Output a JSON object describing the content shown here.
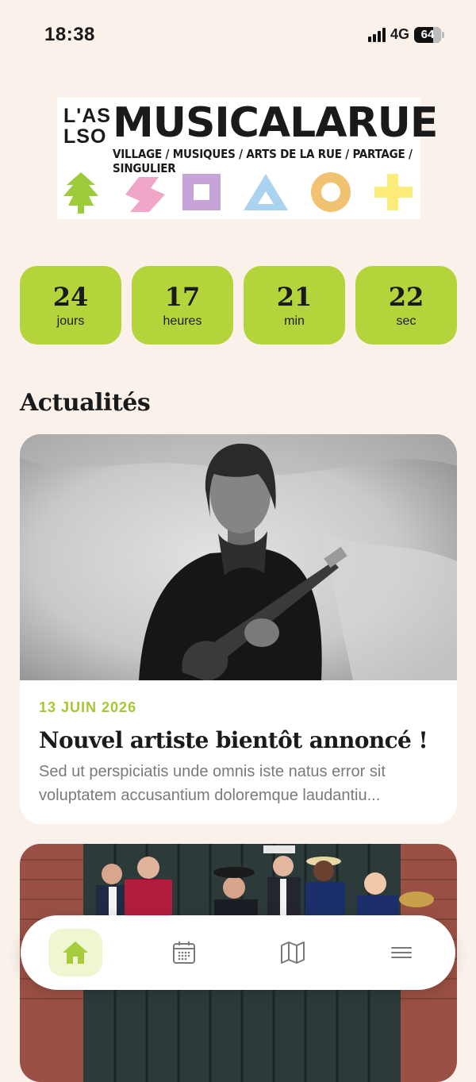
{
  "status_bar": {
    "time": "18:38",
    "network": "4G",
    "battery": "64"
  },
  "logo": {
    "aslo": [
      "L'AS",
      "LSO"
    ],
    "title": "MUSICALARUE",
    "tagline": "VILLAGE / MUSIQUES / ARTS DE LA RUE / PARTAGE / SINGULIER",
    "shapes": [
      {
        "icon": "tree-icon",
        "color": "#9ccb3b"
      },
      {
        "icon": "s-shape-icon",
        "color": "#f0a6c6"
      },
      {
        "icon": "square-icon",
        "color": "#c7a4d8"
      },
      {
        "icon": "triangle-icon",
        "color": "#a9d3ee"
      },
      {
        "icon": "circle-icon",
        "color": "#f0c272"
      },
      {
        "icon": "plus-icon",
        "color": "#fbec7a"
      }
    ]
  },
  "countdown": [
    {
      "value": "24",
      "label": "jours"
    },
    {
      "value": "17",
      "label": "heures"
    },
    {
      "value": "21",
      "label": "min"
    },
    {
      "value": "22",
      "label": "sec"
    }
  ],
  "section": {
    "title": "Actualités"
  },
  "news": [
    {
      "date": "13 JUIN 2026",
      "title": "Nouvel artiste bientôt annoncé !",
      "excerpt": "Sed ut perspiciatis unde omnis iste natus error sit voluptatem accusantium doloremque laudantiu..."
    }
  ],
  "nav": [
    {
      "icon": "home-icon",
      "active": true
    },
    {
      "icon": "calendar-icon",
      "active": false
    },
    {
      "icon": "map-icon",
      "active": false
    },
    {
      "icon": "menu-icon",
      "active": false
    }
  ],
  "colors": {
    "accent": "#b4d43c",
    "background": "#fbf1eb",
    "date": "#a6c832"
  }
}
